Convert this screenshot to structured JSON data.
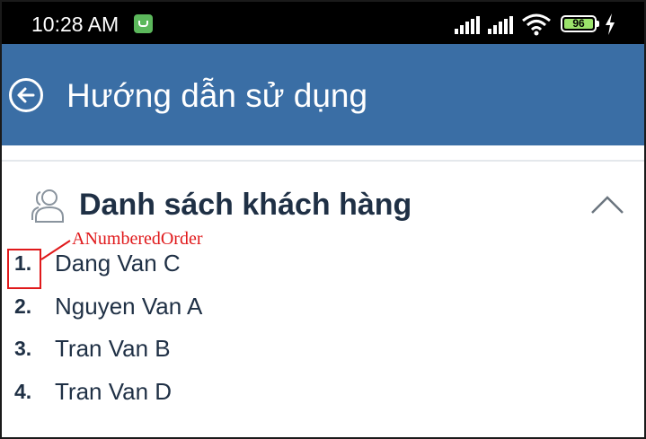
{
  "status_bar": {
    "time": "10:28 AM",
    "battery_level": "96",
    "icons": [
      "app-notification-icon",
      "signal-icon",
      "signal-icon",
      "wifi-icon",
      "battery-icon",
      "charging-icon"
    ]
  },
  "app_bar": {
    "title": "Hướng dẫn sử dụng",
    "back_icon": "back-arrow-circle-icon",
    "background": "#3a6ea5"
  },
  "section": {
    "title": "Danh sách khách hàng",
    "icon": "users-icon",
    "toggle_icon": "chevron-up-icon",
    "items": [
      {
        "number": "1.",
        "name": "Dang Van C"
      },
      {
        "number": "2.",
        "name": "Nguyen Van A"
      },
      {
        "number": "3.",
        "name": "Tran Van B"
      },
      {
        "number": "4.",
        "name": "Tran Van D"
      }
    ]
  },
  "annotation": {
    "label": "ANumberedOrder",
    "color": "#e0191b"
  }
}
